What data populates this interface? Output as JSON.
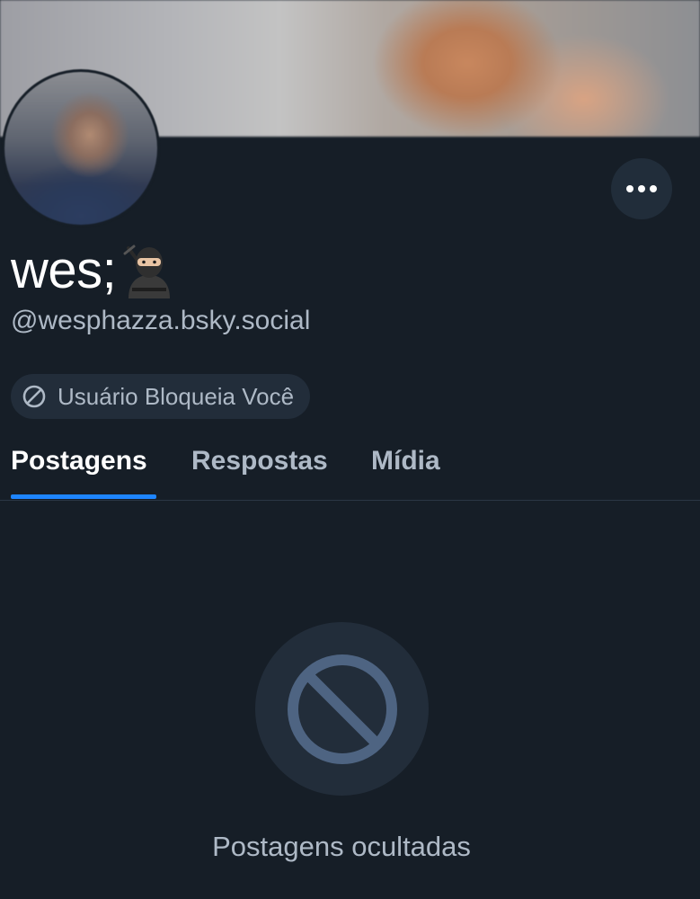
{
  "profile": {
    "display_name": "wes;",
    "display_name_emoji": "ninja",
    "handle": "@wesphazza.bsky.social",
    "block_status": "Usuário Bloqueia Você"
  },
  "tabs": [
    {
      "label": "Postagens",
      "active": true
    },
    {
      "label": "Respostas",
      "active": false
    },
    {
      "label": "Mídia",
      "active": false
    }
  ],
  "feed": {
    "empty_message": "Postagens ocultadas"
  },
  "icons": {
    "more": "more-horizontal-icon",
    "blocked": "block-icon",
    "empty": "block-icon"
  },
  "colors": {
    "background": "#161e27",
    "accent": "#1e85ff",
    "muted_text": "#aeb9c6",
    "chip_bg": "#222d3a",
    "block_icon": "#4e6482"
  }
}
